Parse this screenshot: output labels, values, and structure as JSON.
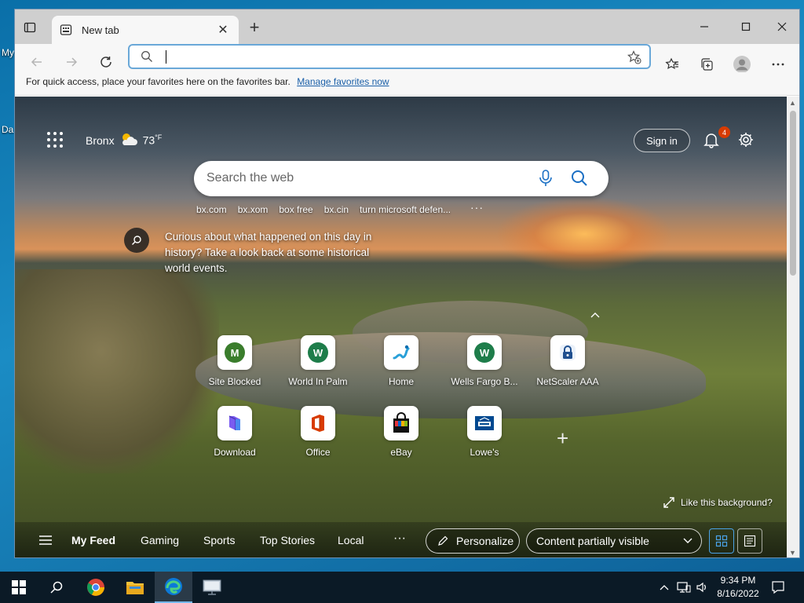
{
  "desktop": {
    "labels": [
      "My",
      "Da"
    ]
  },
  "browser": {
    "tab": {
      "title": "New tab"
    },
    "address": {
      "value": "",
      "placeholder": ""
    },
    "favorites_bar": {
      "message": "For quick access, place your favorites here on the favorites bar.",
      "link": "Manage favorites now"
    }
  },
  "page": {
    "weather": {
      "location": "Bronx",
      "temp": "73",
      "unit": "°F"
    },
    "signin_label": "Sign in",
    "notification_count": "4",
    "search": {
      "placeholder": "Search the web"
    },
    "suggestions": [
      "bx.com",
      "bx.xom",
      "box free",
      "bx.cin",
      "turn microsoft defen..."
    ],
    "history_prompt": "Curious about what happened on this day in history? Take a look back at some historical world events.",
    "quick_links": [
      {
        "label": "Site Blocked",
        "icon": "M",
        "color": "#3a7d2c"
      },
      {
        "label": "World In Palm",
        "icon": "W",
        "color": "#1e7d4a"
      },
      {
        "label": "Home",
        "icon": "home-squiggle-icon",
        "color": "#2aa0d8"
      },
      {
        "label": "Wells Fargo B...",
        "icon": "W",
        "color": "#1e7d4a"
      },
      {
        "label": "NetScaler AAA",
        "icon": "lock-icon",
        "color": "#1f4f8f"
      },
      {
        "label": "Download",
        "icon": "download-app-icon",
        "color": "#6a4ce0"
      },
      {
        "label": "Office",
        "icon": "office-icon",
        "color": "#d83b01"
      },
      {
        "label": "eBay",
        "icon": "shopping-bag-icon",
        "color": "#111111"
      },
      {
        "label": "Lowe's",
        "icon": "lowes-icon",
        "color": "#004990"
      }
    ],
    "like_background": "Like this background?",
    "feed": {
      "items": [
        "My Feed",
        "Gaming",
        "Sports",
        "Top Stories",
        "Local"
      ],
      "personalize": "Personalize",
      "content_visibility": "Content partially visible"
    }
  },
  "taskbar": {
    "time": "9:34 PM",
    "date": "8/16/2022"
  },
  "colors": {
    "accent": "#1a5fa8",
    "notification_badge": "#d83b01",
    "taskbar": "#0b1a26"
  }
}
